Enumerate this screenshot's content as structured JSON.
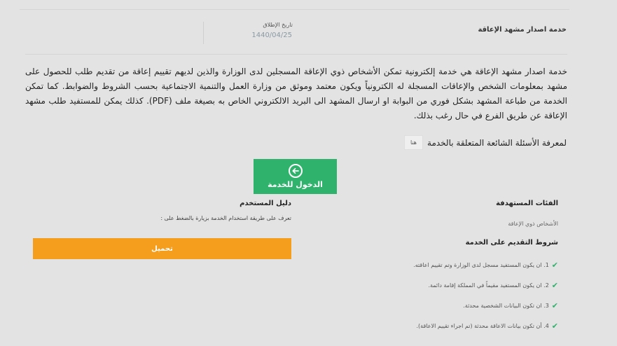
{
  "service": {
    "title": "خدمة اصدار مشهد الإعاقة",
    "launch_label": "تاريخ الإطلاق",
    "launch_date": "1440/04/25",
    "description": "خدمة اصدار مشهد الإعاقة هي خدمة إلكترونية تمكن الأشخاص ذوي الإعاقة المسجلين لدى الوزارة والذين لديهم تقييم إعاقة من تقديم طلب للحصول على مشهد بمعلومات الشخص والإعاقات المسجلة له الكترونياً ويكون معتمد وموثق من وزارة العمل والتنمية الاجتماعية بحسب الشروط والضوابط. كما تمكن الخدمة من طباعة المشهد بشكل فوري من البوابة او ارسال المشهد الى البريد الالكتروني الخاص به بصيغة ملف (PDF). كذلك يمكن للمستفيد طلب مشهد الإعاقة عن طريق الفرع في حال رغب بذلك."
  },
  "faq": {
    "text": "لمعرفة الأسئلة الشائعة المتعلقة بالخدمة",
    "link_label": "هنا"
  },
  "enter_button": {
    "label": "الدخول للخدمة",
    "icon": "arrow-left-circle-icon"
  },
  "user_guide": {
    "title": "دليل المستخدم",
    "text": "تعرف على طريقة استخدام الخدمة بزيارة بالضغط على :",
    "download_label": "تحميل"
  },
  "target_groups": {
    "title": "الفئات المستهدفة",
    "value": "الأشخاص ذوي الإعاقة"
  },
  "conditions": {
    "title": "شروط التقديم على الخدمة",
    "items": [
      "1. ان يكون المستفيد مسجل لدى الوزارة وتم تقييم اعاقته.",
      "2. ان يكون المستفيد مقيماً في المملكة إقامة دائمة.",
      "3. ان تكون البيانات الشخصية محدثة.",
      "4. أن تكون بيانات الاعاقة محدثة (تم اجراء تقييم الاعاقة)."
    ]
  },
  "colors": {
    "primary_green": "#2fb36c",
    "accent_orange": "#f59d1d",
    "background": "#e3e3e3"
  }
}
